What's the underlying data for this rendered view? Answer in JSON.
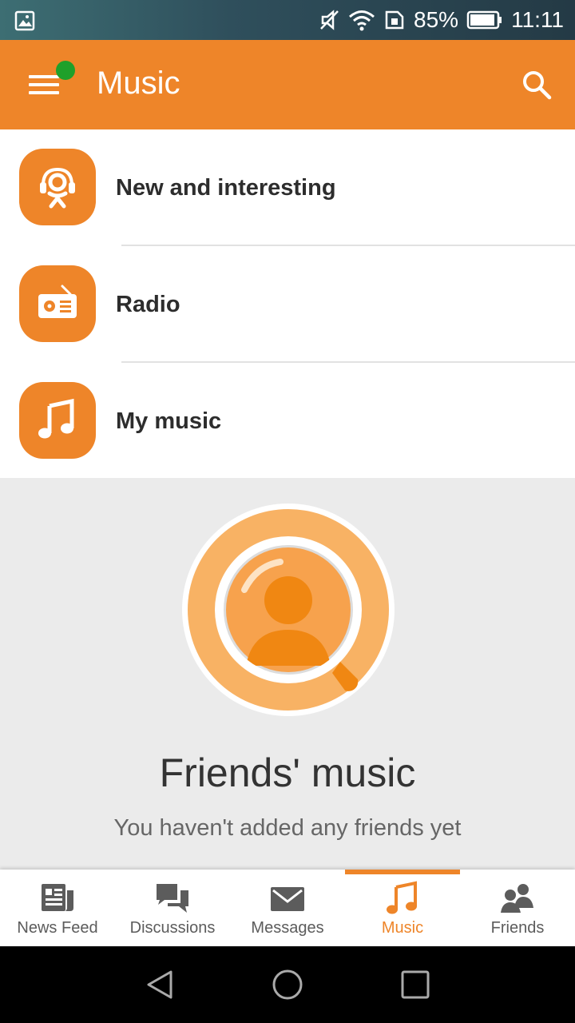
{
  "status_bar": {
    "battery": "85%",
    "time": "11:11"
  },
  "app_bar": {
    "title": "Music"
  },
  "menu_items": [
    {
      "label": "New and interesting",
      "icon": "ok-headphones-icon"
    },
    {
      "label": "Radio",
      "icon": "radio-icon"
    },
    {
      "label": "My music",
      "icon": "music-note-icon"
    }
  ],
  "empty_state": {
    "title": "Friends' music",
    "subtitle": "You haven't added any friends yet"
  },
  "tabs": [
    {
      "label": "News Feed",
      "icon": "newspaper-icon"
    },
    {
      "label": "Discussions",
      "icon": "chat-bubbles-icon"
    },
    {
      "label": "Messages",
      "icon": "envelope-icon"
    },
    {
      "label": "Music",
      "icon": "music-note-icon",
      "active": true
    },
    {
      "label": "Friends",
      "icon": "people-icon"
    }
  ],
  "colors": {
    "accent": "#ee8529",
    "notification_dot": "#1fa02a"
  }
}
